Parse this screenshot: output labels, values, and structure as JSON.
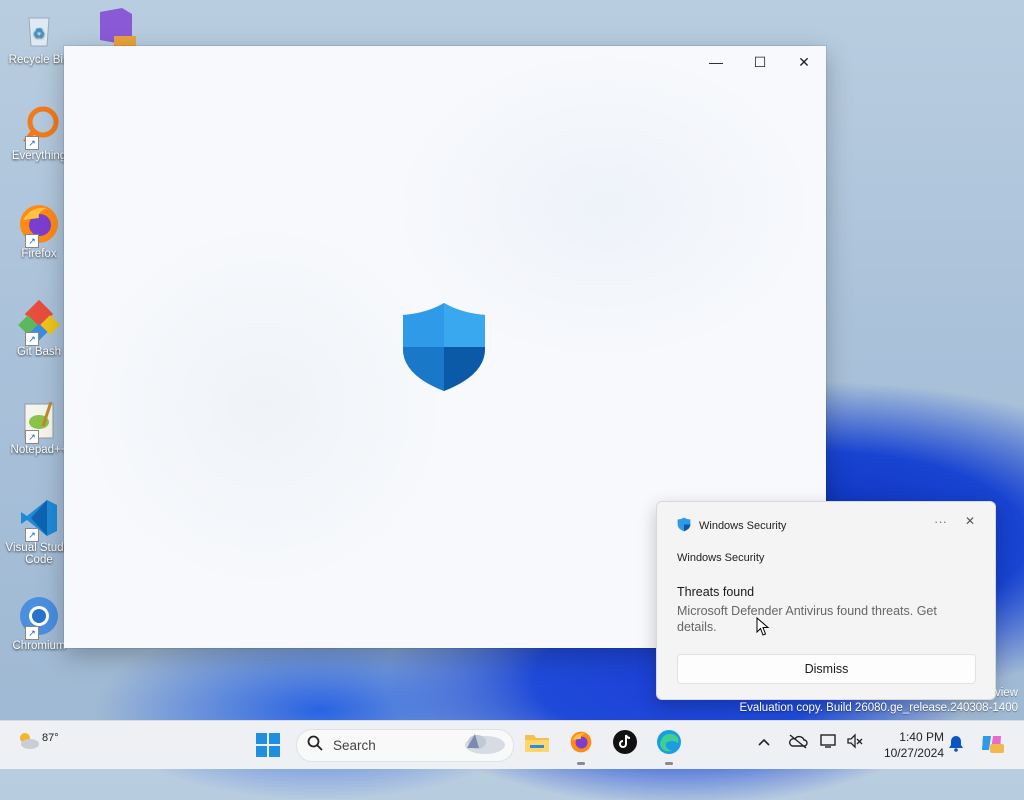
{
  "desktop": {
    "icons": [
      {
        "label": "Recycle Bin"
      },
      {
        "label": "Everything"
      },
      {
        "label": "Firefox"
      },
      {
        "label": "Git Bash"
      },
      {
        "label": "Notepad++"
      },
      {
        "label": "Visual Studio Code"
      },
      {
        "label": "Chromium"
      }
    ]
  },
  "window": {
    "minimize": "—",
    "maximize": "☐",
    "close": "✕"
  },
  "toast": {
    "app_name": "Windows Security",
    "more": "···",
    "close": "✕",
    "subtitle": "Windows Security",
    "title": "Threats found",
    "body": "Microsoft Defender Antivirus found threats. Get details.",
    "dismiss_label": "Dismiss"
  },
  "watermark": {
    "line1": "view",
    "line2": "Evaluation copy. Build 26080.ge_release.240308-1400"
  },
  "taskbar": {
    "weather_temp": "87°",
    "search_label": "Search",
    "time": "1:40 PM",
    "date": "10/27/2024"
  },
  "colors": {
    "accent": "#0067c0",
    "shield_light": "#2f9be8",
    "shield_dark": "#0b5aa8"
  }
}
